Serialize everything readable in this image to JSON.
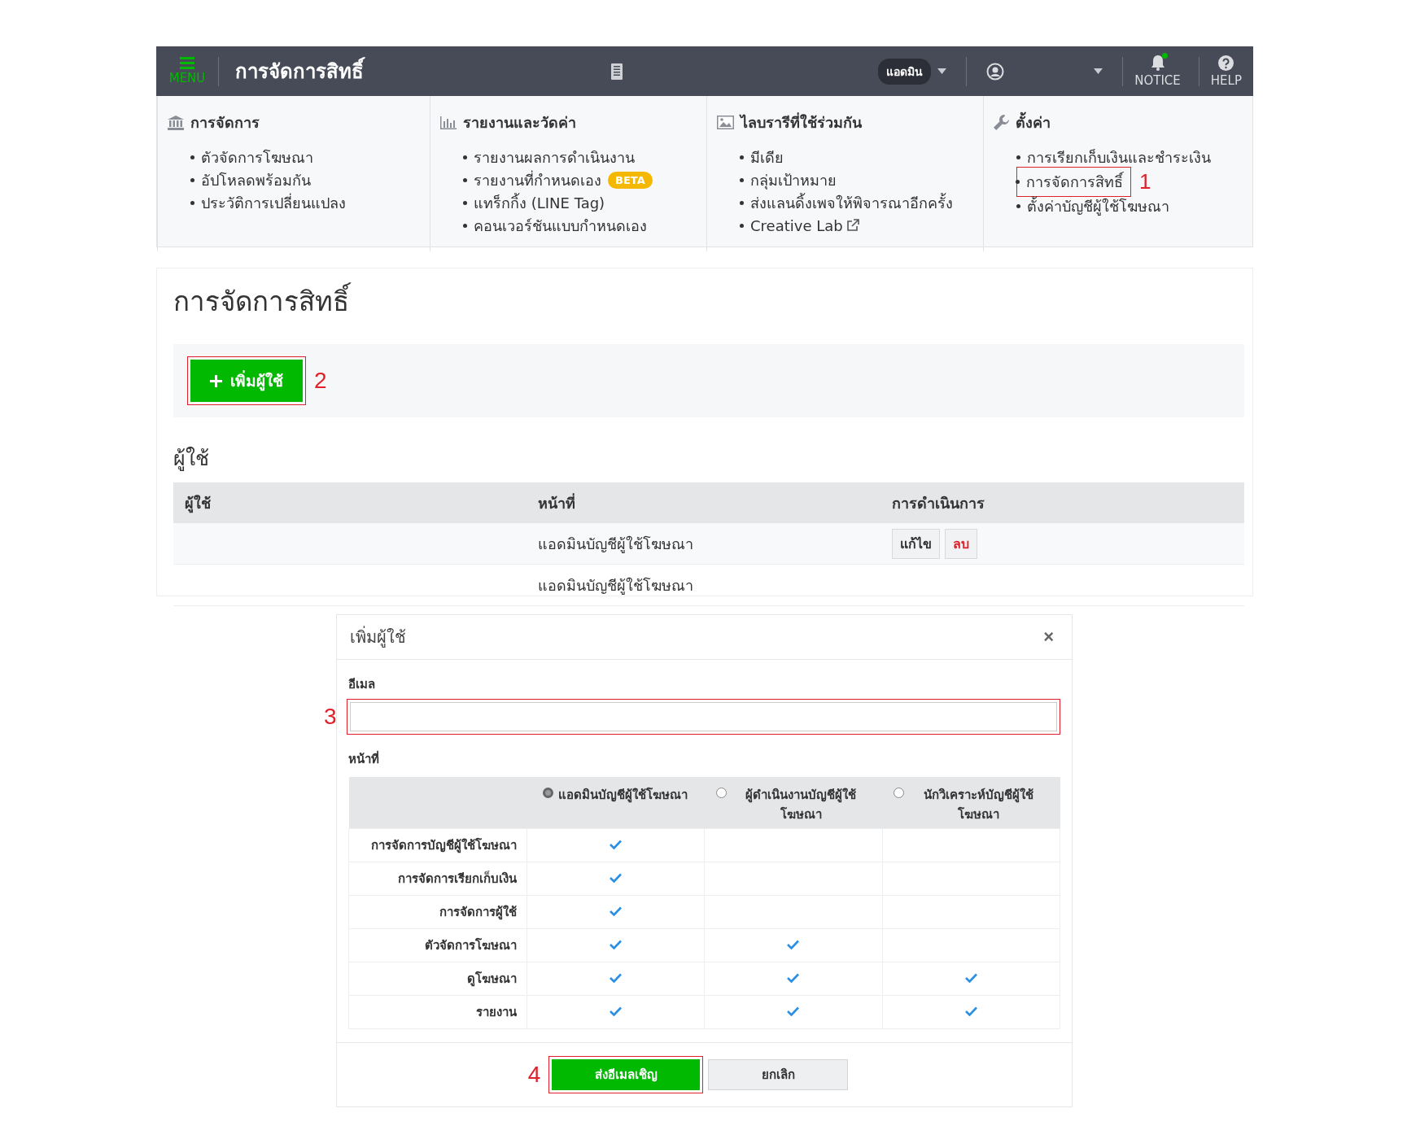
{
  "header": {
    "menu_label": "MENU",
    "title": "การจัดการสิทธิ์",
    "role_badge": "แอดมิน",
    "notice_label": "NOTICE",
    "notice_unread": true,
    "help_label": "HELP"
  },
  "mega_menu": [
    {
      "kind": "bank",
      "title": "การจัดการ",
      "items": [
        {
          "label": "ตัวจัดการโฆษณา"
        },
        {
          "label": "อัปโหลดพร้อมกัน"
        },
        {
          "label": "ประวัติการเปลี่ยนแปลง"
        }
      ]
    },
    {
      "kind": "chart",
      "title": "รายงานและวัดค่า",
      "items": [
        {
          "label": "รายงานผลการดำเนินงาน"
        },
        {
          "label": "รายงานที่กำหนดเอง",
          "badge": "BETA"
        },
        {
          "label": "แทร็กกิ้ง (LINE Tag)"
        },
        {
          "label": "คอนเวอร์ชันแบบกำหนดเอง"
        }
      ]
    },
    {
      "kind": "image",
      "title": "ไลบรารีที่ใช้ร่วมกัน",
      "items": [
        {
          "label": "มีเดีย"
        },
        {
          "label": "กลุ่มเป้าหมาย"
        },
        {
          "label": "ส่งแลนดิ้งเพจให้พิจารณาอีกครั้ง"
        },
        {
          "label": "Creative Lab",
          "external": true
        }
      ]
    },
    {
      "kind": "wrench",
      "title": "ตั้งค่า",
      "items": [
        {
          "label": "การเรียกเก็บเงินและชำระเงิน"
        },
        {
          "label": "การจัดการสิทธิ์",
          "annotation": "1"
        },
        {
          "label": "ตั้งค่าบัญชีผู้ใช้โฆษณา"
        }
      ]
    }
  ],
  "page": {
    "title": "การจัดการสิทธิ์",
    "add_button": {
      "label": "เพิ่มผู้ใช้",
      "annotation": "2"
    },
    "users_heading": "ผู้ใช้",
    "table": {
      "columns": [
        "ผู้ใช้",
        "หน้าที่",
        "การดำเนินการ"
      ],
      "rows": [
        {
          "role": "แอดมินบัญชีผู้ใช้โฆษณา",
          "actions": [
            {
              "kind": "edit",
              "label": "แก้ไข"
            },
            {
              "kind": "delete",
              "label": "ลบ"
            }
          ]
        },
        {
          "role": "แอดมินบัญชีผู้ใช้โฆษณา"
        }
      ]
    }
  },
  "dialog": {
    "title": "เพิ่มผู้ใช้",
    "close": "×",
    "email_label": "อีเมล",
    "email_annotation": "3",
    "role_label": "หน้าที่",
    "roles": [
      {
        "label": "แอดมินบัญชีผู้ใช้โฆษณา",
        "selected": true
      },
      {
        "label": "ผู้ดำเนินงานบัญชีผู้ใช้โฆษณา",
        "selected": false
      },
      {
        "label": "นักวิเคราะห์บัญชีผู้ใช้โฆษณา",
        "selected": false
      }
    ],
    "permissions": [
      {
        "name": "การจัดการบัญชีผู้ใช้โฆษณา",
        "checks": [
          true,
          false,
          false
        ]
      },
      {
        "name": "การจัดการเรียกเก็บเงิน",
        "checks": [
          true,
          false,
          false
        ]
      },
      {
        "name": "การจัดการผู้ใช้",
        "checks": [
          true,
          false,
          false
        ]
      },
      {
        "name": "ตัวจัดการโฆษณา",
        "checks": [
          true,
          true,
          false
        ]
      },
      {
        "name": "ดูโฆษณา",
        "checks": [
          true,
          true,
          true
        ]
      },
      {
        "name": "รายงาน",
        "checks": [
          true,
          true,
          true
        ]
      }
    ],
    "send_button": {
      "label": "ส่งอีเมลเชิญ",
      "annotation": "4"
    },
    "cancel_button": "ยกเลิก"
  }
}
